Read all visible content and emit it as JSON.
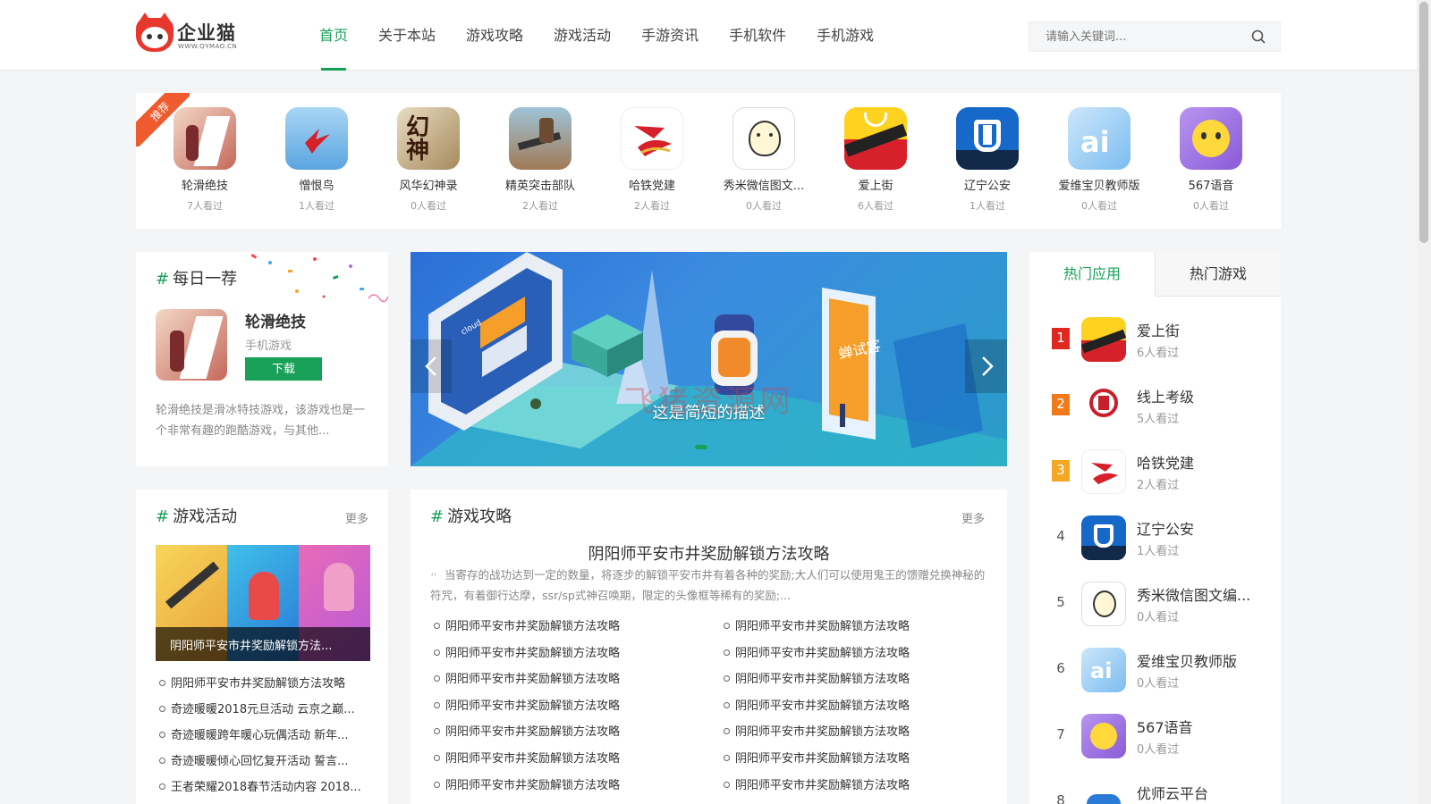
{
  "header": {
    "logo_name": "企业猫",
    "logo_url": "WWW.QYMAO.CN",
    "nav": [
      "首页",
      "关于本站",
      "游戏攻略",
      "游戏活动",
      "手游资讯",
      "手机软件",
      "手机游戏"
    ],
    "search_placeholder": "请输入关键词..."
  },
  "recommend": {
    "badge": "推荐",
    "apps": [
      {
        "name": "轮滑绝技",
        "views": "7人看过"
      },
      {
        "name": "憎恨鸟",
        "views": "1人看过"
      },
      {
        "name": "风华幻神录",
        "views": "0人看过"
      },
      {
        "name": "精英突击部队",
        "views": "2人看过"
      },
      {
        "name": "哈铁党建",
        "views": "2人看过"
      },
      {
        "name": "秀米微信图文...",
        "views": "0人看过"
      },
      {
        "name": "爱上街",
        "views": "6人看过"
      },
      {
        "name": "辽宁公安",
        "views": "1人看过"
      },
      {
        "name": "爱维宝贝教师版",
        "views": "0人看过"
      },
      {
        "name": "567语音",
        "views": "0人看过"
      }
    ]
  },
  "daily": {
    "title": "每日一荐",
    "app_name": "轮滑绝技",
    "category": "手机游戏",
    "download": "下载",
    "desc": "轮滑绝技是滑冰特技游戏，该游戏也是一个非常有趣的跑酷游戏，与其他..."
  },
  "banner": {
    "caption": "这是简短的描述",
    "phone_text": "蝉试客",
    "screen_text": "cloud"
  },
  "hot": {
    "tabs": [
      "热门应用",
      "热门游戏"
    ],
    "items": [
      {
        "rank": "1",
        "name": "爱上街",
        "views": "6人看过"
      },
      {
        "rank": "2",
        "name": "线上考级",
        "views": "5人看过"
      },
      {
        "rank": "3",
        "name": "哈铁党建",
        "views": "2人看过"
      },
      {
        "rank": "4",
        "name": "辽宁公安",
        "views": "1人看过"
      },
      {
        "rank": "5",
        "name": "秀米微信图文编...",
        "views": "0人看过"
      },
      {
        "rank": "6",
        "name": "爱维宝贝教师版",
        "views": "0人看过"
      },
      {
        "rank": "7",
        "name": "567语音",
        "views": "0人看过"
      },
      {
        "rank": "8",
        "name": "优师云平台",
        "views": ""
      }
    ]
  },
  "events": {
    "title": "游戏活动",
    "more": "更多",
    "featured": "阴阳师平安市井奖励解锁方法...",
    "list": [
      "阴阳师平安市井奖励解锁方法攻略",
      "奇迹暖暖2018元旦活动 云京之巅...",
      "奇迹暖暖跨年暖心玩偶活动 新年...",
      "奇迹暖暖倾心回忆复开活动 誓言...",
      "王者荣耀2018春节活动内容 2018..."
    ]
  },
  "guides": {
    "title": "游戏攻略",
    "more": "更多",
    "headline": "阴阳师平安市井奖励解锁方法攻略",
    "summary": "当寄存的战功达到一定的数量，将逐步的解锁平安市井有着各种的奖励;大人们可以使用鬼王的馈赠兑换神秘的符咒，有着御行达摩，ssr/sp式神召唤期，限定的头像框等稀有的奖励;...",
    "left": [
      "阴阳师平安市井奖励解锁方法攻略",
      "阴阳师平安市井奖励解锁方法攻略",
      "阴阳师平安市井奖励解锁方法攻略",
      "阴阳师平安市井奖励解锁方法攻略",
      "阴阳师平安市井奖励解锁方法攻略",
      "阴阳师平安市井奖励解锁方法攻略",
      "阴阳师平安市井奖励解锁方法攻略"
    ],
    "right": [
      "阴阳师平安市井奖励解锁方法攻略",
      "阴阳师平安市井奖励解锁方法攻略",
      "阴阳师平安市井奖励解锁方法攻略",
      "阴阳师平安市井奖励解锁方法攻略",
      "阴阳师平安市井奖励解锁方法攻略",
      "阴阳师平安市井奖励解锁方法攻略",
      "阴阳师平安市井奖励解锁方法攻略"
    ]
  },
  "watermark": "飞猪资源网",
  "colors": {
    "accent": "#18a058",
    "badge": "#ef5a2e",
    "rank1": "#e0281e",
    "rank2": "#f07a1a",
    "rank3": "#f5a623"
  }
}
